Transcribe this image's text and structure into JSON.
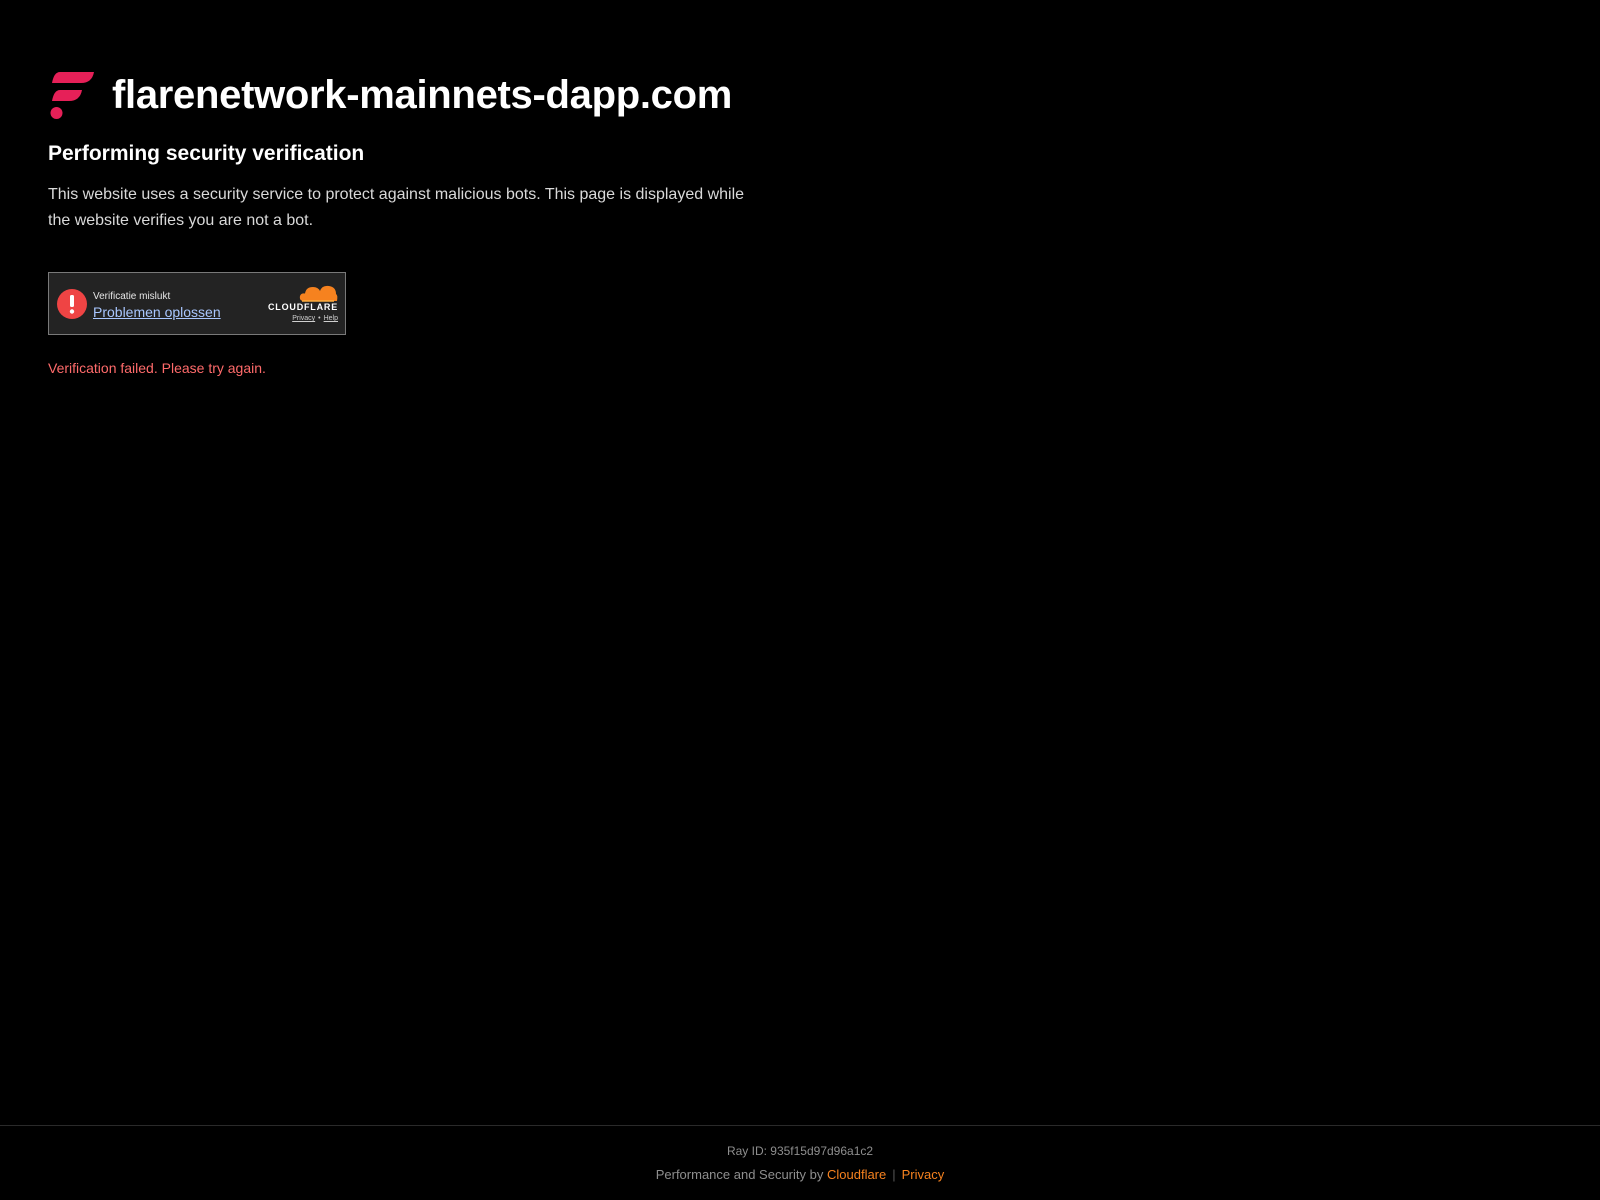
{
  "site": {
    "title": "flarenetwork-mainnets-dapp.com",
    "logo_icon": "flare-logo-icon",
    "brand_color": "#e62058"
  },
  "main": {
    "heading": "Performing security verification",
    "description": "This website uses a security service to protect against malicious bots. This page is displayed while the website verifies you are not a bot.",
    "error": "Verification failed. Please try again.",
    "error_color": "#ff6b6b"
  },
  "widget": {
    "status": "Verificatie mislukt",
    "link": "Problemen oplossen",
    "alert_icon": "alert-circle-icon",
    "alert_color": "#ef4444",
    "brand": "CLOUDFLARE",
    "brand_icon": "cloudflare-cloud-icon",
    "privacy_link": "Privacy",
    "links_separator": "•",
    "help_link": "Help"
  },
  "footer": {
    "ray_id": "Ray ID: 935f15d97d96a1c2",
    "performance_prefix": "Performance and Security by",
    "cloudflare_link": "Cloudflare",
    "separator": "|",
    "privacy_link": "Privacy",
    "link_color": "#f6821f"
  }
}
